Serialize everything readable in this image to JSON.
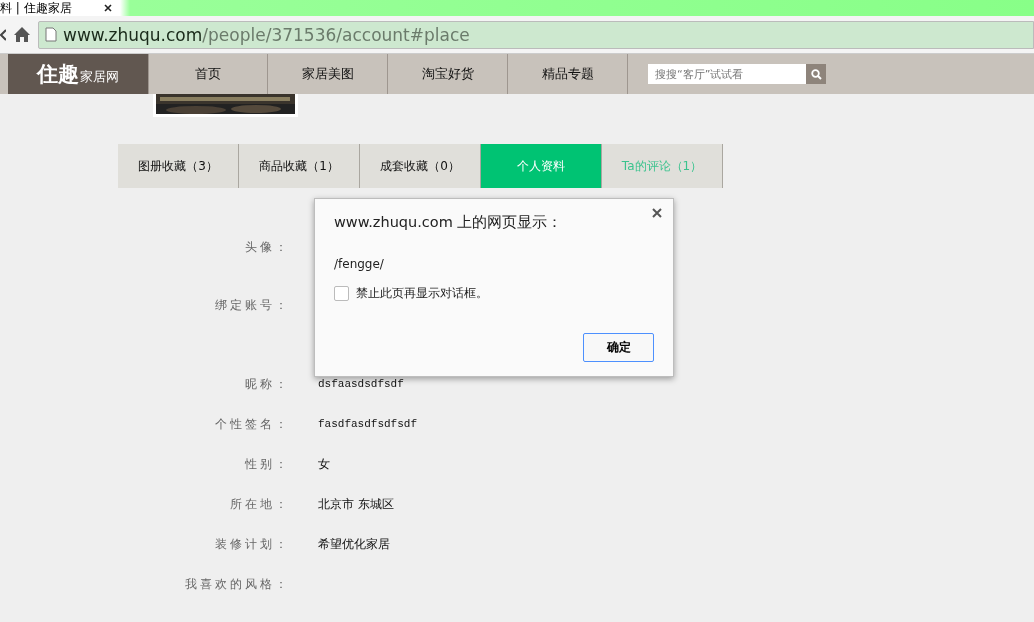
{
  "browser": {
    "tab_title": "料 | 住趣家居",
    "url_host": "www.zhuqu.com",
    "url_path": "/people/371536/account#place"
  },
  "site_nav": {
    "logo_main": "住趣",
    "logo_sub": "家居网",
    "items": [
      {
        "label": "首页"
      },
      {
        "label": "家居美图"
      },
      {
        "label": "淘宝好货"
      },
      {
        "label": "精品专题"
      }
    ],
    "search": {
      "placeholder": "搜搜“客厅”试试看"
    }
  },
  "profile_tabs": [
    {
      "label": "图册收藏（3）",
      "selected": false,
      "kind": "normal"
    },
    {
      "label": "商品收藏（1）",
      "selected": false,
      "kind": "normal"
    },
    {
      "label": "成套收藏（0）",
      "selected": false,
      "kind": "normal"
    },
    {
      "label": "个人资料",
      "selected": true,
      "kind": "normal"
    },
    {
      "label": "Ta的评论（1）",
      "selected": false,
      "kind": "link"
    }
  ],
  "fields": [
    {
      "label": "头像：",
      "kind": "avatar"
    },
    {
      "label": "绑定账号：",
      "kind": "binding"
    },
    {
      "label": "昵称：",
      "value": "dsfaasdsdfsdf",
      "kind": "mono"
    },
    {
      "label": "个性签名：",
      "value": "fasdfasdfsdfsdf",
      "kind": "mono"
    },
    {
      "label": "性别：",
      "value": "女",
      "kind": "text"
    },
    {
      "label": "所在地：",
      "value": "北京市 东城区",
      "kind": "text"
    },
    {
      "label": "装修计划：",
      "value": "希望优化家居",
      "kind": "text"
    },
    {
      "label": "我喜欢的风格：",
      "kind": "text"
    }
  ],
  "dialog": {
    "title": "www.zhuqu.com 上的网页显示：",
    "message": "/fengge/",
    "checkbox": {
      "label": "禁止此页再显示对话框。",
      "checked": false
    },
    "ok": "确定"
  }
}
